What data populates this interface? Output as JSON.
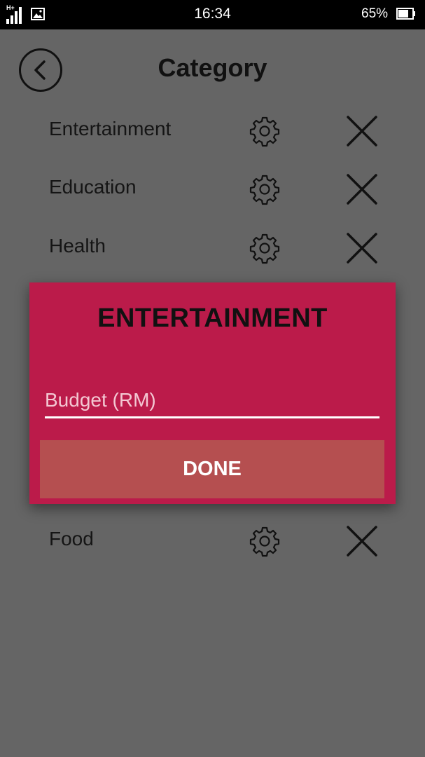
{
  "status_bar": {
    "network": "H+",
    "time": "16:34",
    "battery": "65%"
  },
  "header": {
    "title": "Category",
    "back_icon": "back-arrow-icon"
  },
  "categories": [
    {
      "label": "Entertainment"
    },
    {
      "label": "Education"
    },
    {
      "label": "Health"
    },
    {
      "label": "Food"
    }
  ],
  "dialog": {
    "title": "ENTERTAINMENT",
    "budget_placeholder": "Budget (RM)",
    "budget_value": "",
    "done_label": "DONE"
  },
  "colors": {
    "background": "#656565",
    "dialog": "#bb1b4a",
    "done_button": "#b54f50",
    "input_underline": "#ffffff"
  }
}
